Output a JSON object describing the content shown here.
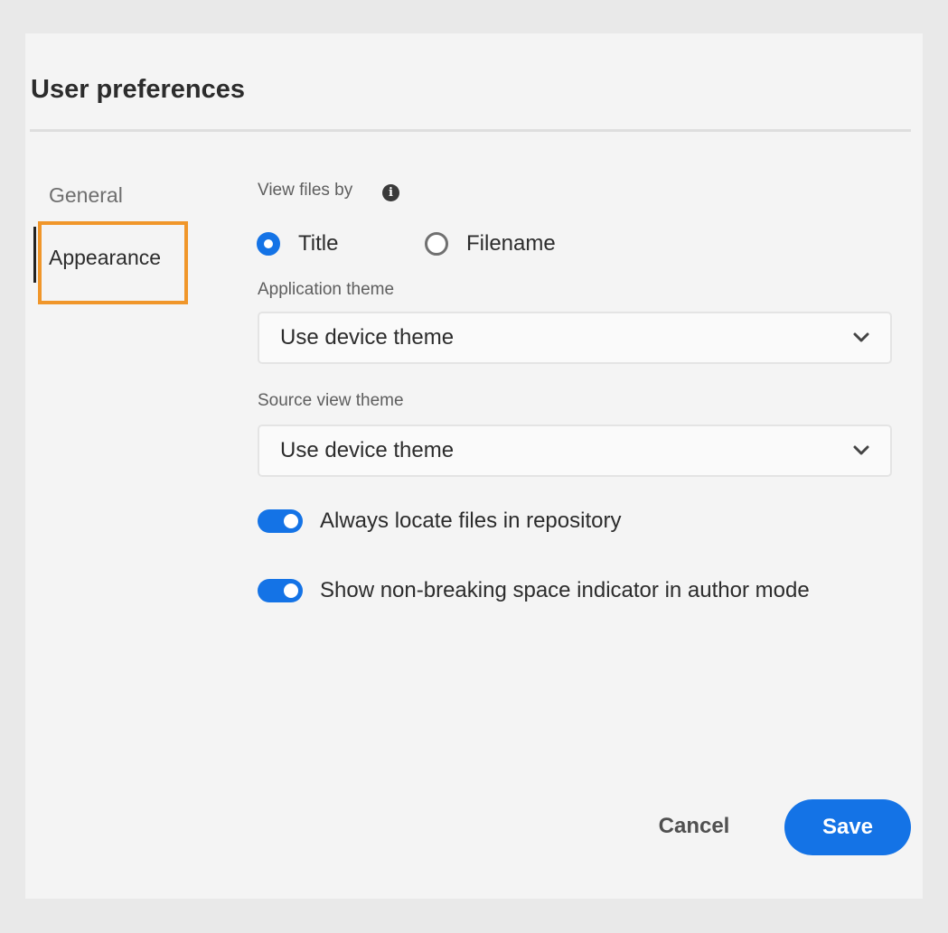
{
  "dialog": {
    "title": "User preferences"
  },
  "nav": {
    "items": [
      {
        "label": "General",
        "selected": false
      },
      {
        "label": "Appearance",
        "selected": true
      }
    ]
  },
  "view_files_by": {
    "label": "View files by",
    "info_icon": "info-icon",
    "options": [
      {
        "label": "Title",
        "checked": true
      },
      {
        "label": "Filename",
        "checked": false
      }
    ]
  },
  "application_theme": {
    "label": "Application theme",
    "value": "Use device theme"
  },
  "source_view_theme": {
    "label": "Source view theme",
    "value": "Use device theme"
  },
  "toggles": [
    {
      "label": "Always locate files in repository",
      "on": true
    },
    {
      "label": "Show non-breaking space indicator in author mode",
      "on": true
    }
  ],
  "buttons": {
    "cancel": "Cancel",
    "save": "Save"
  },
  "colors": {
    "accent": "#1473e6",
    "highlight": "#f0962a",
    "dialog_bg": "#f4f4f4",
    "page_bg": "#e9e9e9"
  }
}
